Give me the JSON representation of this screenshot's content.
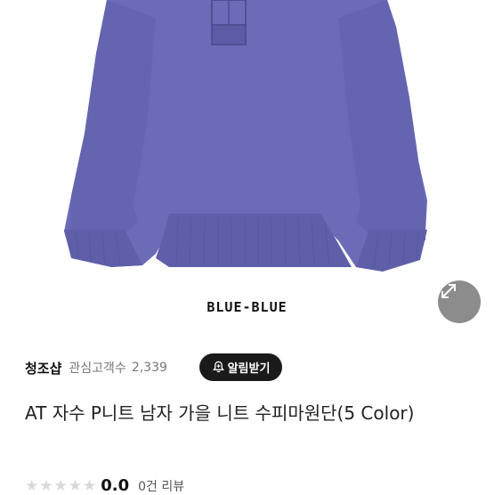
{
  "product_image": {
    "brand_logo": "BLUE-BLUE",
    "expand_icon": "expand-arrows-icon",
    "colors": {
      "sweater": "#6b6bb8",
      "sweater_shadow": "#5e5ea9",
      "expand_button": "#8c8c8c"
    }
  },
  "seller": {
    "name": "청조샵",
    "follower_label": "관심고객수",
    "follower_count": "2,339",
    "notify_label": "알림받기",
    "notify_icon": "bell-plus-icon"
  },
  "product": {
    "title": "AT 자수 P니트 남자 가을 니트 수피마원단(5 Color)"
  },
  "rating": {
    "stars_filled": 0,
    "stars_total": 5,
    "value": "0.0",
    "review_count": "0건 리뷰"
  }
}
